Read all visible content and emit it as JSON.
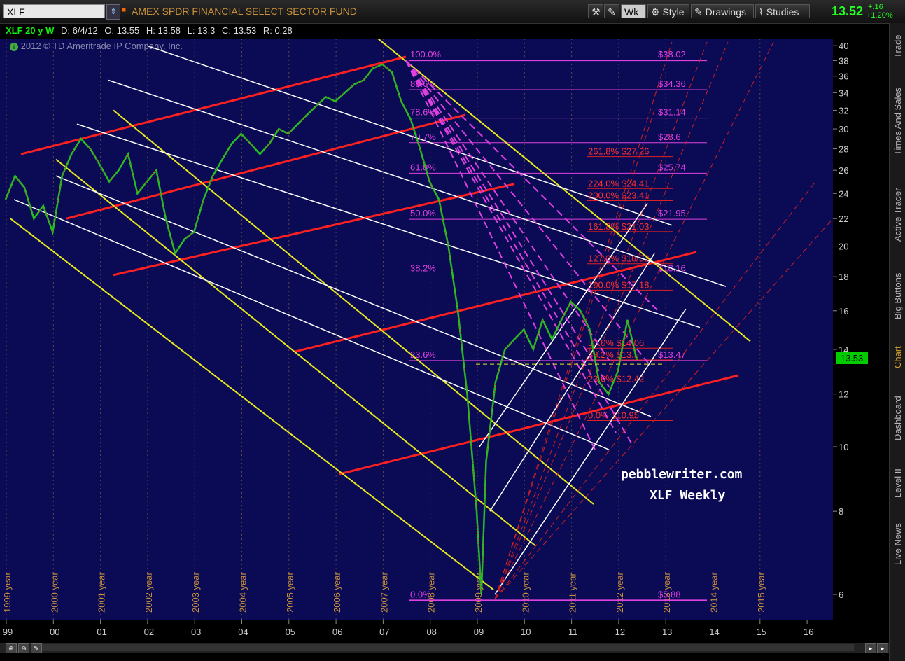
{
  "toolbar": {
    "symbol": "XLF",
    "fund_name": "AMEX SPDR FINANCIAL SELECT SECTOR FUND",
    "wk_label": "Wk",
    "style_label": "Style",
    "drawings_label": "Drawings",
    "studies_label": "Studies",
    "last_price": "13.52",
    "change_abs": "+.16",
    "change_pct": "+1.20%"
  },
  "info": {
    "ticker": "XLF 20 y W",
    "date": "D: 6/4/12",
    "open": "O: 13.55",
    "high": "H: 13.58",
    "low": "L: 13.3",
    "close": "C: 13.53",
    "range": "R: 0.28"
  },
  "copyright": "2012 © TD Ameritrade IP Company, Inc.",
  "watermark": {
    "line1": "pebblewriter.com",
    "line2": "XLF Weekly"
  },
  "price_tag": "13.53",
  "sidebar_tabs": [
    "Trade",
    "Times And Sales",
    "Active Trader",
    "Big Buttons",
    "Chart",
    "Dashboard",
    "Level II",
    "Live News"
  ],
  "colors": {
    "plot_bg": "#0a0a55",
    "price_up": "#22c322",
    "price_down": "#e02020",
    "fib_magenta": "#e040e0",
    "channel_red": "#ff2020",
    "channel_yellow": "#e8e820",
    "channel_white": "#ffffff",
    "axis_label": "#c8903a"
  },
  "chart_data": {
    "type": "line",
    "title": "XLF 20 y W",
    "y_scale": "log",
    "ylim": [
      5.5,
      41
    ],
    "yticks": [
      6,
      8,
      10,
      12,
      14,
      16,
      18,
      20,
      22,
      24,
      26,
      28,
      30,
      32,
      34,
      36,
      38,
      40
    ],
    "x_ticks": [
      "99",
      "00",
      "01",
      "02",
      "03",
      "04",
      "05",
      "06",
      "07",
      "08",
      "09",
      "10",
      "11",
      "12",
      "13",
      "14",
      "15",
      "16"
    ],
    "x_year_labels": [
      "1999 year",
      "2000 year",
      "2001 year",
      "2002 year",
      "2003 year",
      "2004 year",
      "2005 year",
      "2006 year",
      "2007 year",
      "2008 year",
      "2009 year",
      "2010 year",
      "2011 year",
      "2012 year",
      "2013 year",
      "2014 year",
      "2015 year"
    ],
    "series": [
      {
        "name": "XLF",
        "x": [
          1999.0,
          1999.2,
          1999.4,
          1999.6,
          1999.8,
          2000.0,
          2000.2,
          2000.4,
          2000.6,
          2000.8,
          2001.0,
          2001.2,
          2001.4,
          2001.6,
          2001.8,
          2002.0,
          2002.2,
          2002.4,
          2002.6,
          2002.8,
          2003.0,
          2003.2,
          2003.4,
          2003.6,
          2003.8,
          2004.0,
          2004.2,
          2004.4,
          2004.6,
          2004.8,
          2005.0,
          2005.2,
          2005.4,
          2005.6,
          2005.8,
          2006.0,
          2006.2,
          2006.4,
          2006.6,
          2006.8,
          2007.0,
          2007.2,
          2007.4,
          2007.6,
          2007.8,
          2008.0,
          2008.2,
          2008.4,
          2008.6,
          2008.8,
          2009.0,
          2009.1,
          2009.2,
          2009.4,
          2009.6,
          2009.8,
          2010.0,
          2010.2,
          2010.4,
          2010.6,
          2010.8,
          2011.0,
          2011.2,
          2011.4,
          2011.6,
          2011.8,
          2012.0,
          2012.2,
          2012.4
        ],
        "values": [
          23.5,
          25.5,
          24.5,
          22.0,
          23.0,
          21.0,
          25.5,
          27.5,
          29.0,
          28.0,
          26.5,
          25.0,
          26.0,
          27.5,
          24.0,
          25.0,
          26.0,
          22.0,
          19.5,
          20.5,
          21.0,
          23.5,
          25.5,
          27.0,
          28.5,
          29.5,
          28.5,
          27.5,
          28.5,
          30.0,
          29.5,
          30.5,
          31.5,
          32.5,
          33.5,
          33.0,
          34.0,
          35.0,
          35.5,
          37.0,
          37.5,
          36.5,
          33.0,
          31.0,
          28.0,
          25.0,
          23.5,
          20.0,
          16.0,
          12.0,
          8.0,
          6.0,
          9.5,
          12.5,
          14.0,
          14.5,
          15.0,
          14.0,
          15.5,
          14.5,
          15.5,
          16.5,
          16.0,
          15.0,
          12.5,
          12.0,
          13.0,
          15.5,
          13.5
        ]
      }
    ],
    "fib_retracement": [
      {
        "label": "100.0%",
        "value": "$38.02"
      },
      {
        "label": "88.6%",
        "value": "$34.36"
      },
      {
        "label": "78.6%",
        "value": "$31.14"
      },
      {
        "label": "70.7%",
        "value": "$28.6"
      },
      {
        "label": "61.8%",
        "value": "$25.74"
      },
      {
        "label": "50.0%",
        "value": "$21.95"
      },
      {
        "label": "38.2%",
        "value": "$18.16"
      },
      {
        "label": "23.6%",
        "value": "$13.47"
      },
      {
        "label": "0.0%",
        "value": "$5.88"
      }
    ],
    "fib_extension": [
      {
        "label": "261.8%",
        "value": "$27.26"
      },
      {
        "label": "224.0%",
        "value": "$24.41"
      },
      {
        "label": "200.0%",
        "value": "$23.41"
      },
      {
        "label": "161.8%",
        "value": "$21.03"
      },
      {
        "label": "127.2%",
        "value": "$18.82"
      },
      {
        "label": "100.0%",
        "value": "$17.18"
      },
      {
        "label": "50.0%",
        "value": "$14.06"
      },
      {
        "label": "38.2%",
        "value": "$13.5"
      },
      {
        "label": "23.6%",
        "value": "$12.42"
      },
      {
        "label": "0.0%",
        "value": "$10.95"
      }
    ]
  }
}
